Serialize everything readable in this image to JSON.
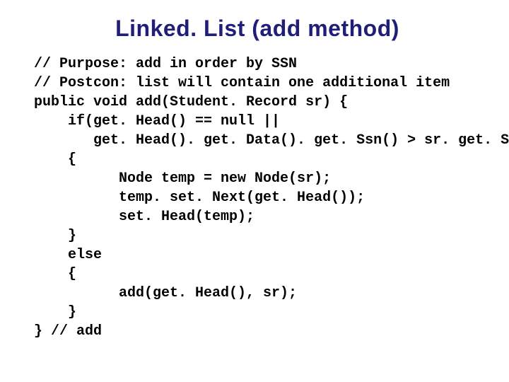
{
  "title": "Linked. List (add method)",
  "code": {
    "l01": "// Purpose: add in order by SSN",
    "l02": "// Postcon: list will contain one additional item",
    "l03": "public void add(Student. Record sr) {",
    "l04": "    if(get. Head() == null ||",
    "l05": "       get. Head(). get. Data(). get. Ssn() > sr. get. Ssn() )",
    "l06": "    {",
    "l07": "          Node temp = new Node(sr);",
    "l08": "          temp. set. Next(get. Head());",
    "l09": "          set. Head(temp);",
    "l10": "    }",
    "l11": "    else",
    "l12": "    {",
    "l13": "          add(get. Head(), sr);",
    "l14": "    }",
    "l15": "} // add"
  }
}
